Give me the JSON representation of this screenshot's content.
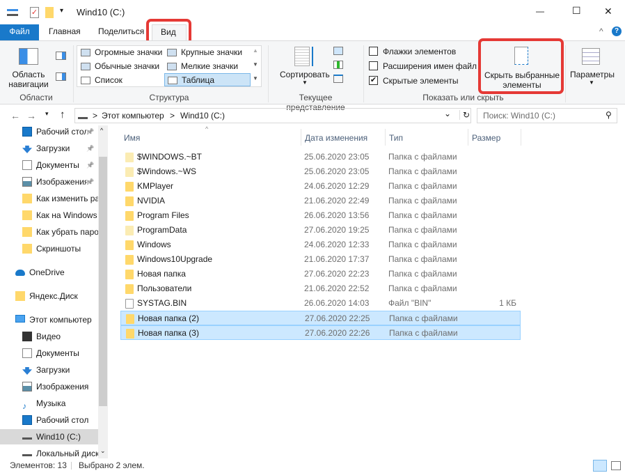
{
  "window": {
    "title": "Wind10 (C:)",
    "minimize": "—",
    "maximize": "☐",
    "close": "✕"
  },
  "tabs": [
    {
      "label": "Файл"
    },
    {
      "label": "Главная"
    },
    {
      "label": "Поделиться"
    },
    {
      "label": "Вид",
      "active": true
    }
  ],
  "ribbon": {
    "collapse": "^",
    "help": "?",
    "nav_pane": "Область навигации",
    "groups": [
      "Области",
      "Структура",
      "Текущее представление",
      "Показать или скрыть"
    ],
    "layouts": [
      "Огромные значки",
      "Крупные значки",
      "Обычные значки",
      "Мелкие значки",
      "Список",
      "Таблица"
    ],
    "selected_layout": "Таблица",
    "sort": "Сортировать",
    "checkboxes": [
      {
        "label": "Флажки элементов",
        "checked": false
      },
      {
        "label": "Расширения имен файлов",
        "checked": false
      },
      {
        "label": "Скрытые элементы",
        "checked": true
      }
    ],
    "check_mark": "✔",
    "hide_selected": "Скрыть выбранные элементы",
    "options": "Параметры"
  },
  "address": {
    "path": [
      "Этот компьютер",
      "Wind10 (C:)"
    ],
    "separator": ">",
    "search_placeholder": "Поиск: Wind10 (C:)",
    "back": "←",
    "forward": "→",
    "up": "↑",
    "history": "⌄",
    "refresh": "↻",
    "search_icon": "⚲"
  },
  "sidebar": {
    "items": [
      {
        "label": "Рабочий стол",
        "icon": "desktop",
        "pinned": true,
        "indent": 1
      },
      {
        "label": "Загрузки",
        "icon": "download",
        "pinned": true,
        "indent": 1
      },
      {
        "label": "Документы",
        "icon": "document",
        "pinned": true,
        "indent": 1
      },
      {
        "label": "Изображения",
        "icon": "pictures",
        "pinned": true,
        "indent": 1
      },
      {
        "label": "Как изменить разрешение",
        "icon": "folder",
        "indent": 1
      },
      {
        "label": "Как на Windows",
        "icon": "folder",
        "indent": 1
      },
      {
        "label": "Как убрать пароль",
        "icon": "folder",
        "indent": 1
      },
      {
        "label": "Скриншоты",
        "icon": "folder-synced",
        "indent": 1
      },
      {
        "label": "OneDrive",
        "icon": "cloud",
        "indent": 0,
        "gap": true
      },
      {
        "label": "Яндекс.Диск",
        "icon": "yandex-disk",
        "indent": 0,
        "gap": true
      },
      {
        "label": "Этот компьютер",
        "icon": "computer",
        "indent": 0,
        "gap": true
      },
      {
        "label": "Видео",
        "icon": "video",
        "indent": 1
      },
      {
        "label": "Документы",
        "icon": "document",
        "indent": 1
      },
      {
        "label": "Загрузки",
        "icon": "download",
        "indent": 1
      },
      {
        "label": "Изображения",
        "icon": "pictures",
        "indent": 1
      },
      {
        "label": "Музыка",
        "icon": "music",
        "indent": 1
      },
      {
        "label": "Рабочий стол",
        "icon": "desktop",
        "indent": 1
      },
      {
        "label": "Wind10 (C:)",
        "icon": "drive",
        "indent": 1,
        "selected": true
      },
      {
        "label": "Локальный диск",
        "icon": "drive",
        "indent": 1
      }
    ]
  },
  "columns": [
    "Имя",
    "Дата изменения",
    "Тип",
    "Размер"
  ],
  "files": [
    {
      "name": "$WINDOWS.~BT",
      "date": "25.06.2020 23:05",
      "type": "Папка с файлами",
      "size": "",
      "kind": "pale"
    },
    {
      "name": "$Windows.~WS",
      "date": "25.06.2020 23:05",
      "type": "Папка с файлами",
      "size": "",
      "kind": "pale"
    },
    {
      "name": "KMPlayer",
      "date": "24.06.2020 12:29",
      "type": "Папка с файлами",
      "size": "",
      "kind": "folder"
    },
    {
      "name": "NVIDIA",
      "date": "21.06.2020 22:49",
      "type": "Папка с файлами",
      "size": "",
      "kind": "folder"
    },
    {
      "name": "Program Files",
      "date": "26.06.2020 13:56",
      "type": "Папка с файлами",
      "size": "",
      "kind": "folder"
    },
    {
      "name": "ProgramData",
      "date": "27.06.2020 19:25",
      "type": "Папка с файлами",
      "size": "",
      "kind": "pale"
    },
    {
      "name": "Windows",
      "date": "24.06.2020 12:33",
      "type": "Папка с файлами",
      "size": "",
      "kind": "folder"
    },
    {
      "name": "Windows10Upgrade",
      "date": "21.06.2020 17:37",
      "type": "Папка с файлами",
      "size": "",
      "kind": "folder"
    },
    {
      "name": "Новая папка",
      "date": "27.06.2020 22:23",
      "type": "Папка с файлами",
      "size": "",
      "kind": "folder"
    },
    {
      "name": "Пользователи",
      "date": "21.06.2020 22:52",
      "type": "Папка с файлами",
      "size": "",
      "kind": "folder"
    },
    {
      "name": "SYSTAG.BIN",
      "date": "26.06.2020 14:03",
      "type": "Файл \"BIN\"",
      "size": "1 КБ",
      "kind": "file"
    },
    {
      "name": "Новая папка (2)",
      "date": "27.06.2020 22:25",
      "type": "Папка с файлами",
      "size": "",
      "kind": "folder",
      "selected": true
    },
    {
      "name": "Новая папка (3)",
      "date": "27.06.2020 22:26",
      "type": "Папка с файлами",
      "size": "",
      "kind": "folder",
      "selected": true
    }
  ],
  "status": {
    "count": "Элементов: 13",
    "selected": "Выбрано 2 элем."
  },
  "colors": {
    "accent": "#1979ca",
    "highlight": "#e53935",
    "selection": "#cce8ff"
  }
}
